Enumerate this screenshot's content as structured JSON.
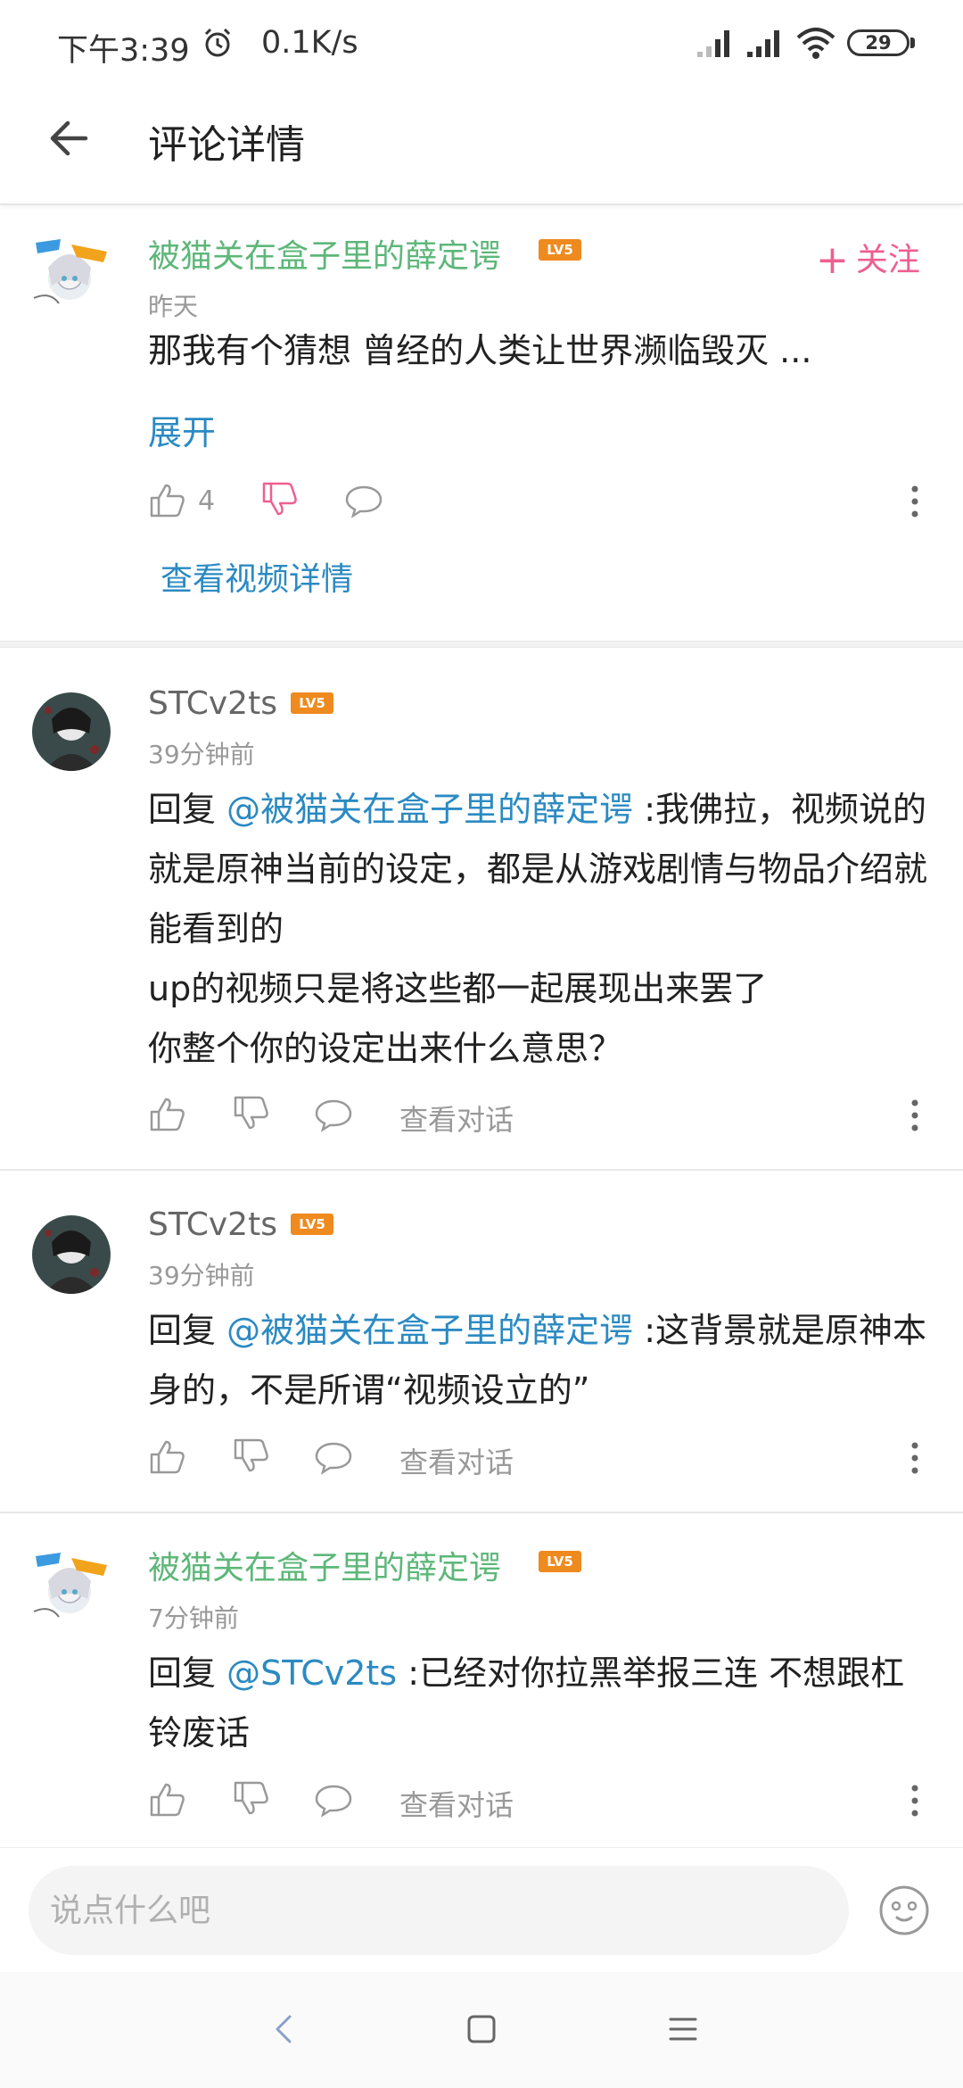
{
  "status_bar": {
    "time": "下午3:39",
    "speed": "0.1K/s",
    "battery": "29"
  },
  "header": {
    "title": "评论详情"
  },
  "main_comment": {
    "username": "被猫关在盒子里的薛定谔",
    "level": "LV5",
    "time": "昨天",
    "text": "那我有个猜想  曾经的人类让世界濒临毁灭  ...",
    "expand": "展开",
    "follow": "关注",
    "like_count": "4",
    "video_link": "查看视频详情"
  },
  "replies": [
    {
      "username": "STCv2ts",
      "level": "LV5",
      "time": "39分钟前",
      "prefix": "回复 ",
      "mention": "@被猫关在盒子里的薛定谔",
      "text": " :我佛拉，视频说的就是原神当前的设定，都是从游戏剧情与物品介绍就能看到的",
      "text2": "up的视频只是将这些都一起展现出来罢了",
      "text3": "你整个你的设定出来什么意思？",
      "view_dialog": "查看对话"
    },
    {
      "username": "STCv2ts",
      "level": "LV5",
      "time": "39分钟前",
      "prefix": "回复 ",
      "mention": "@被猫关在盒子里的薛定谔",
      "text": " :这背景就是原神本身的，不是所谓“视频设立的”",
      "view_dialog": "查看对话"
    },
    {
      "username": "被猫关在盒子里的薛定谔",
      "level": "LV5",
      "time": "7分钟前",
      "prefix": "回复 ",
      "mention": "@STCv2ts",
      "text": " :已经对你拉黑举报三连  不想跟杠铃废话",
      "view_dialog": "查看对话"
    }
  ],
  "input": {
    "placeholder": "说点什么吧"
  },
  "icons": {
    "alarm": "alarm-icon",
    "signal": "signal-icon",
    "wifi": "wifi-icon",
    "back": "back-arrow-icon",
    "like": "thumbs-up-icon",
    "dislike": "thumbs-down-icon",
    "comment": "comment-bubble-icon",
    "more": "more-vertical-icon",
    "emoji": "emoji-icon"
  },
  "colors": {
    "username_green": "#5db779",
    "link_blue": "#2b8ac2",
    "follow_pink": "#ef5f8f",
    "level_orange": "#ef8a1f"
  }
}
